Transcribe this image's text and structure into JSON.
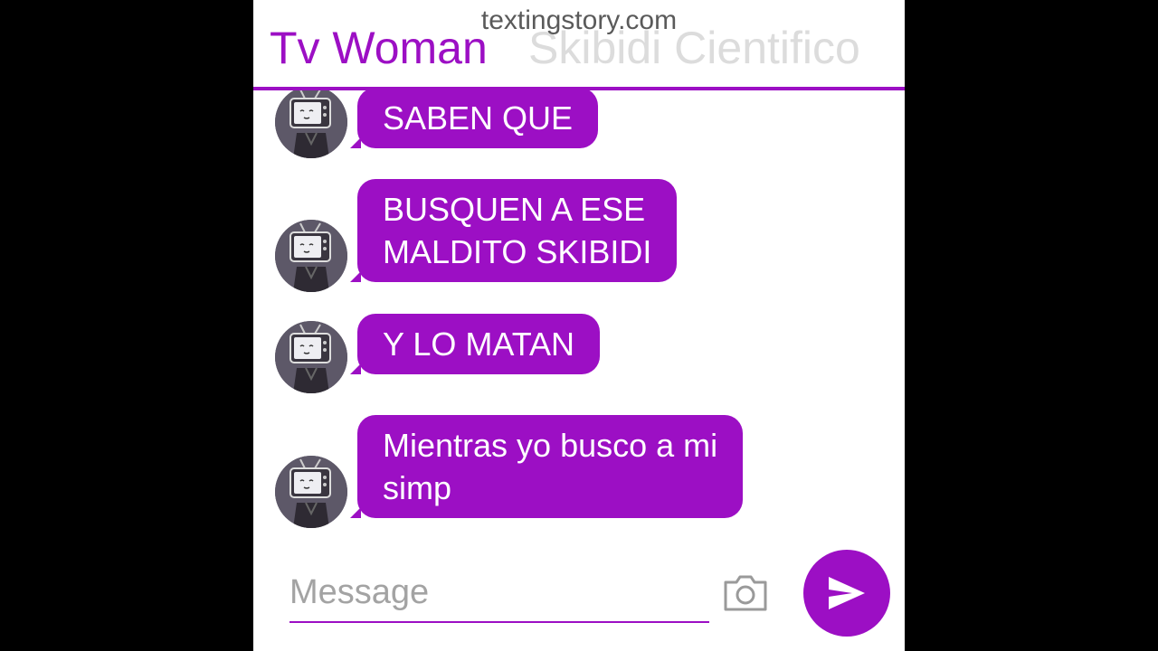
{
  "watermark": "textingstory.com",
  "header": {
    "active_tab": "Tv Woman",
    "inactive_tab": "Skibidi Cientifico"
  },
  "messages": [
    {
      "sender": "Tv Woman",
      "avatar_icon": "tv-woman-avatar-icon",
      "text_lines": [
        "SABEN QUE"
      ]
    },
    {
      "sender": "Tv Woman",
      "avatar_icon": "tv-woman-avatar-icon",
      "text_lines": [
        "BUSQUEN A ESE",
        "MALDITO SKIBIDI"
      ]
    },
    {
      "sender": "Tv Woman",
      "avatar_icon": "tv-woman-avatar-icon",
      "text_lines": [
        "Y LO MATAN"
      ]
    },
    {
      "sender": "Tv Woman",
      "avatar_icon": "tv-woman-avatar-icon",
      "text_lines": [
        "Mientras yo busco a mi",
        "simp"
      ]
    }
  ],
  "composer": {
    "placeholder": "Message",
    "value": "",
    "camera_icon": "camera-icon",
    "send_icon": "send-icon"
  },
  "colors": {
    "accent": "#9c0fc4",
    "inactive_tab": "#dcdcdc",
    "background": "#ffffff",
    "letterbox": "#000000"
  }
}
